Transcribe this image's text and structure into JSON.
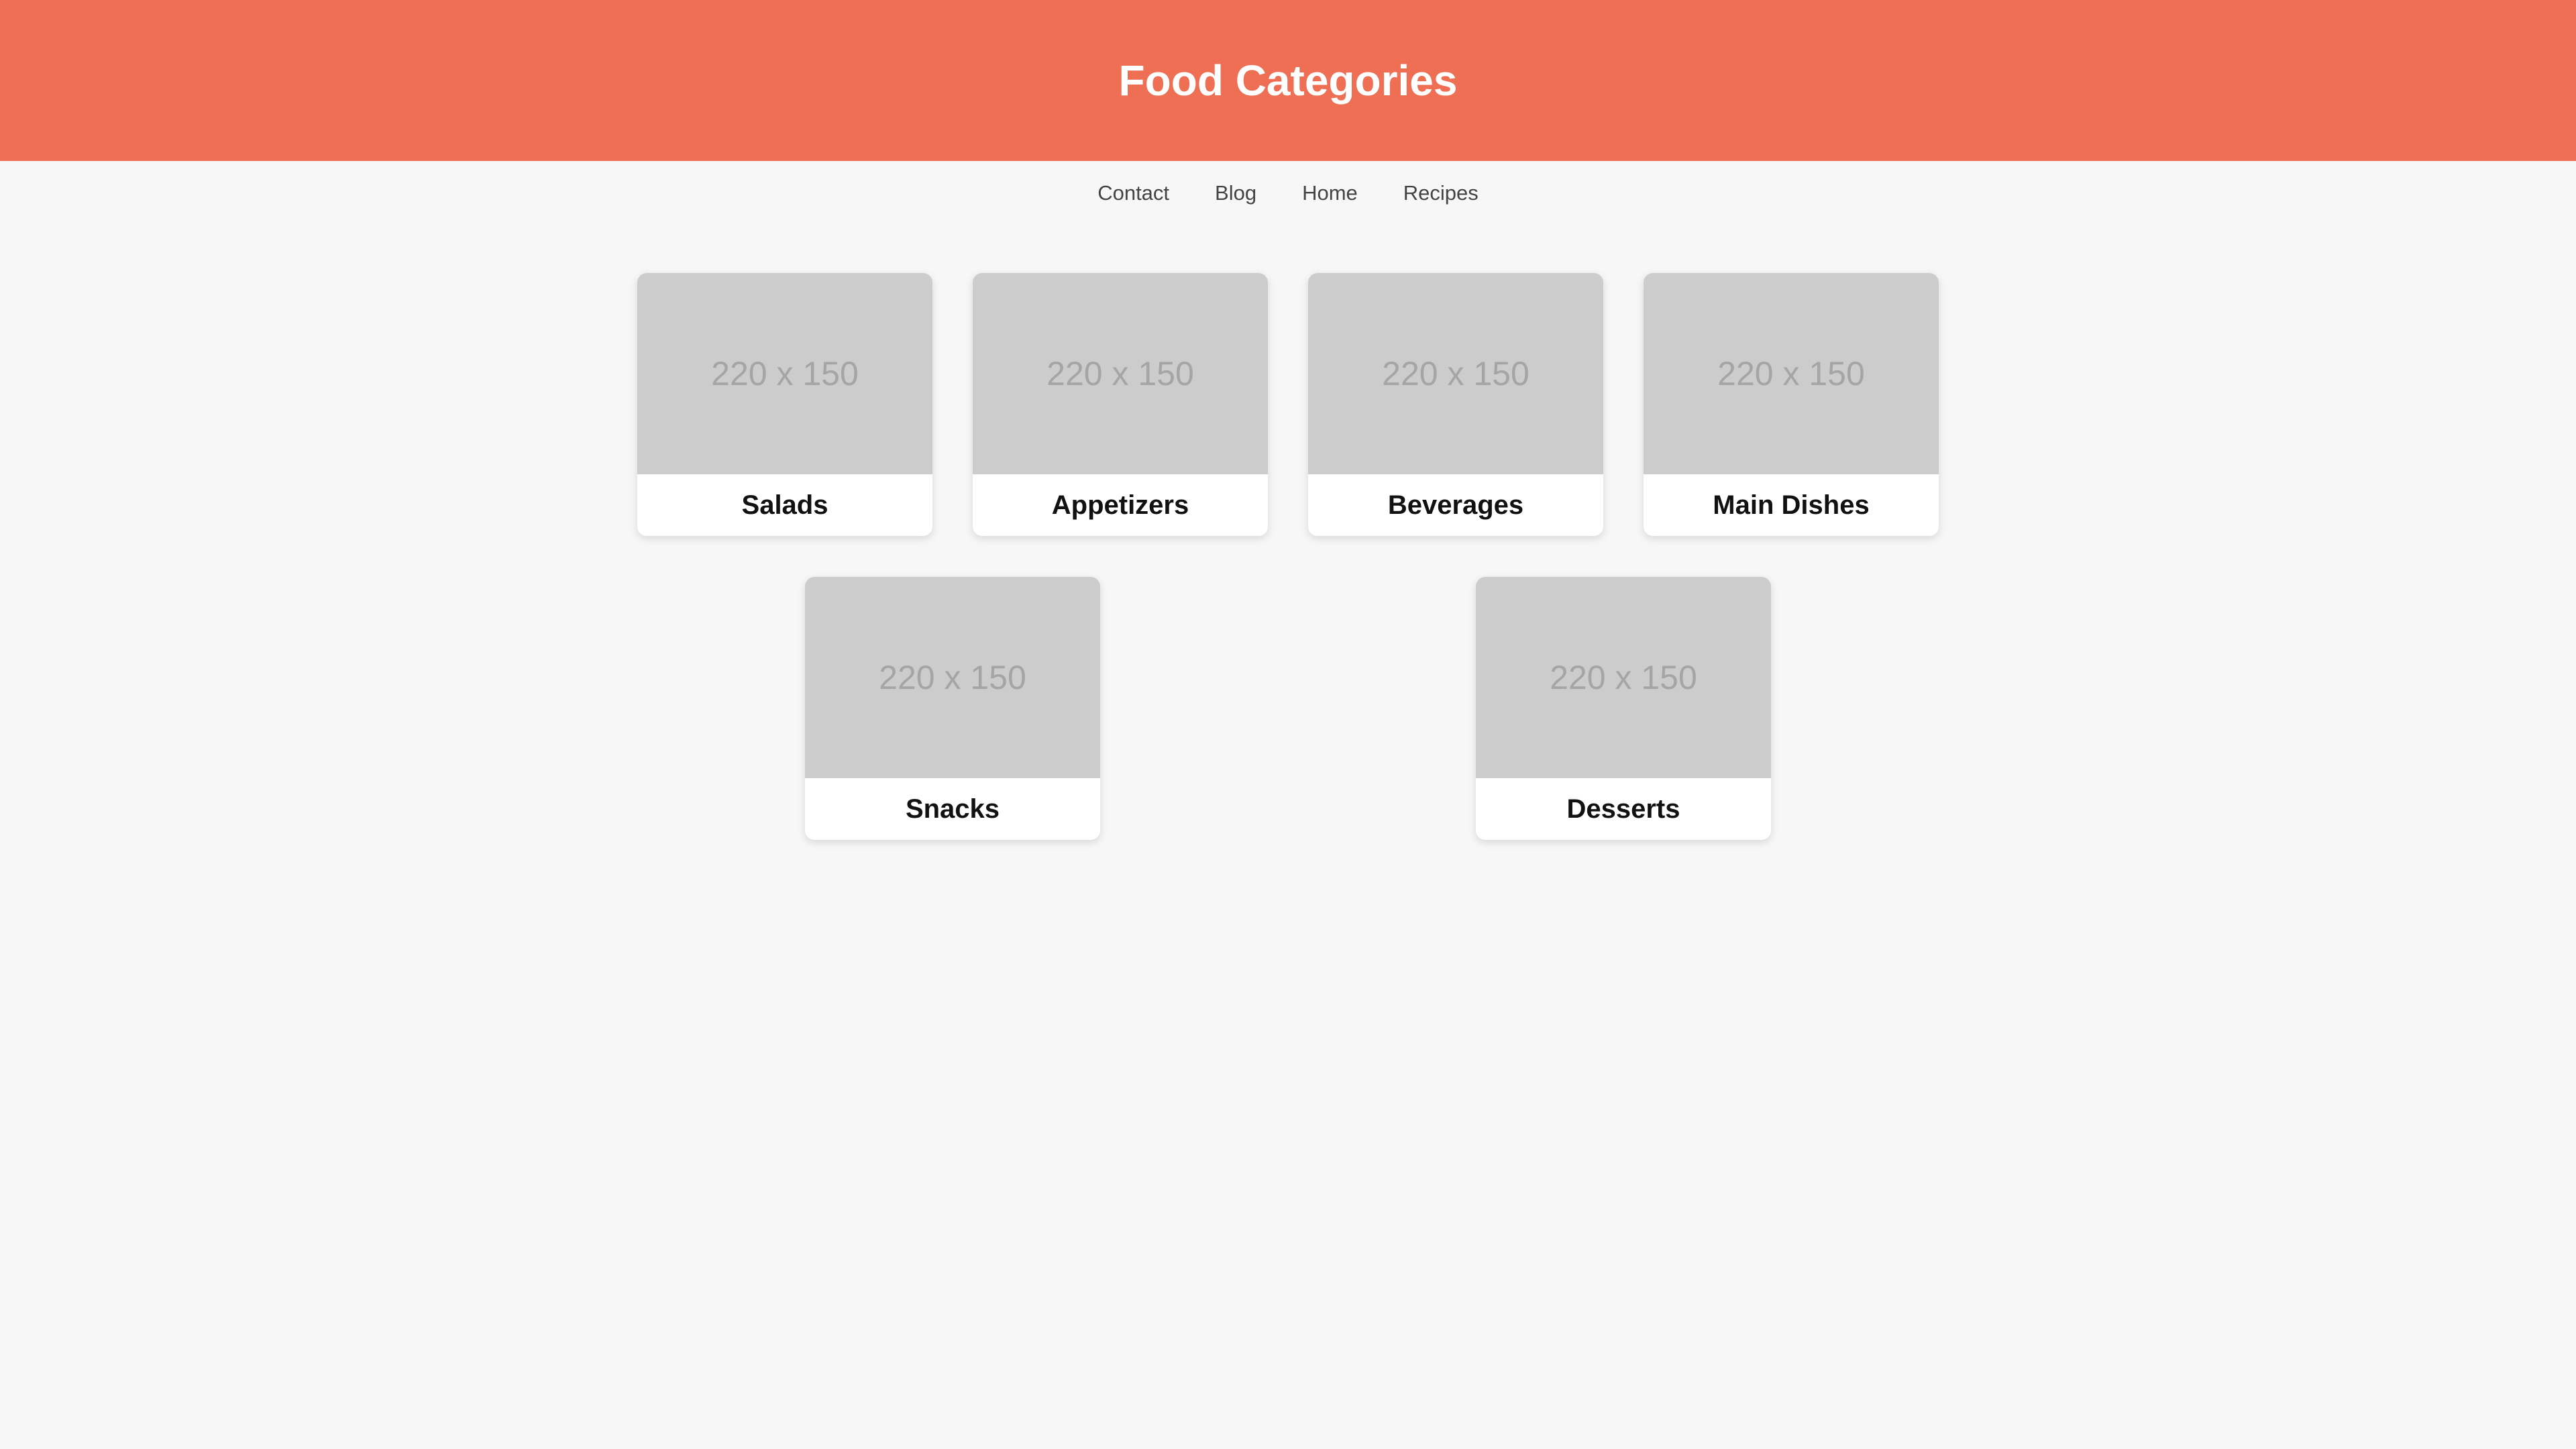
{
  "header": {
    "title": "Food Categories"
  },
  "nav": {
    "items": [
      "Contact",
      "Blog",
      "Home",
      "Recipes"
    ]
  },
  "categories": [
    {
      "name": "Salads",
      "image_placeholder": "220 x 150"
    },
    {
      "name": "Appetizers",
      "image_placeholder": "220 x 150"
    },
    {
      "name": "Beverages",
      "image_placeholder": "220 x 150"
    },
    {
      "name": "Main Dishes",
      "image_placeholder": "220 x 150"
    },
    {
      "name": "Snacks",
      "image_placeholder": "220 x 150"
    },
    {
      "name": "Desserts",
      "image_placeholder": "220 x 150"
    }
  ],
  "colors": {
    "header_bg": "#ef6f55",
    "page_bg": "#f7f7f7",
    "placeholder_bg": "#cccccc"
  }
}
